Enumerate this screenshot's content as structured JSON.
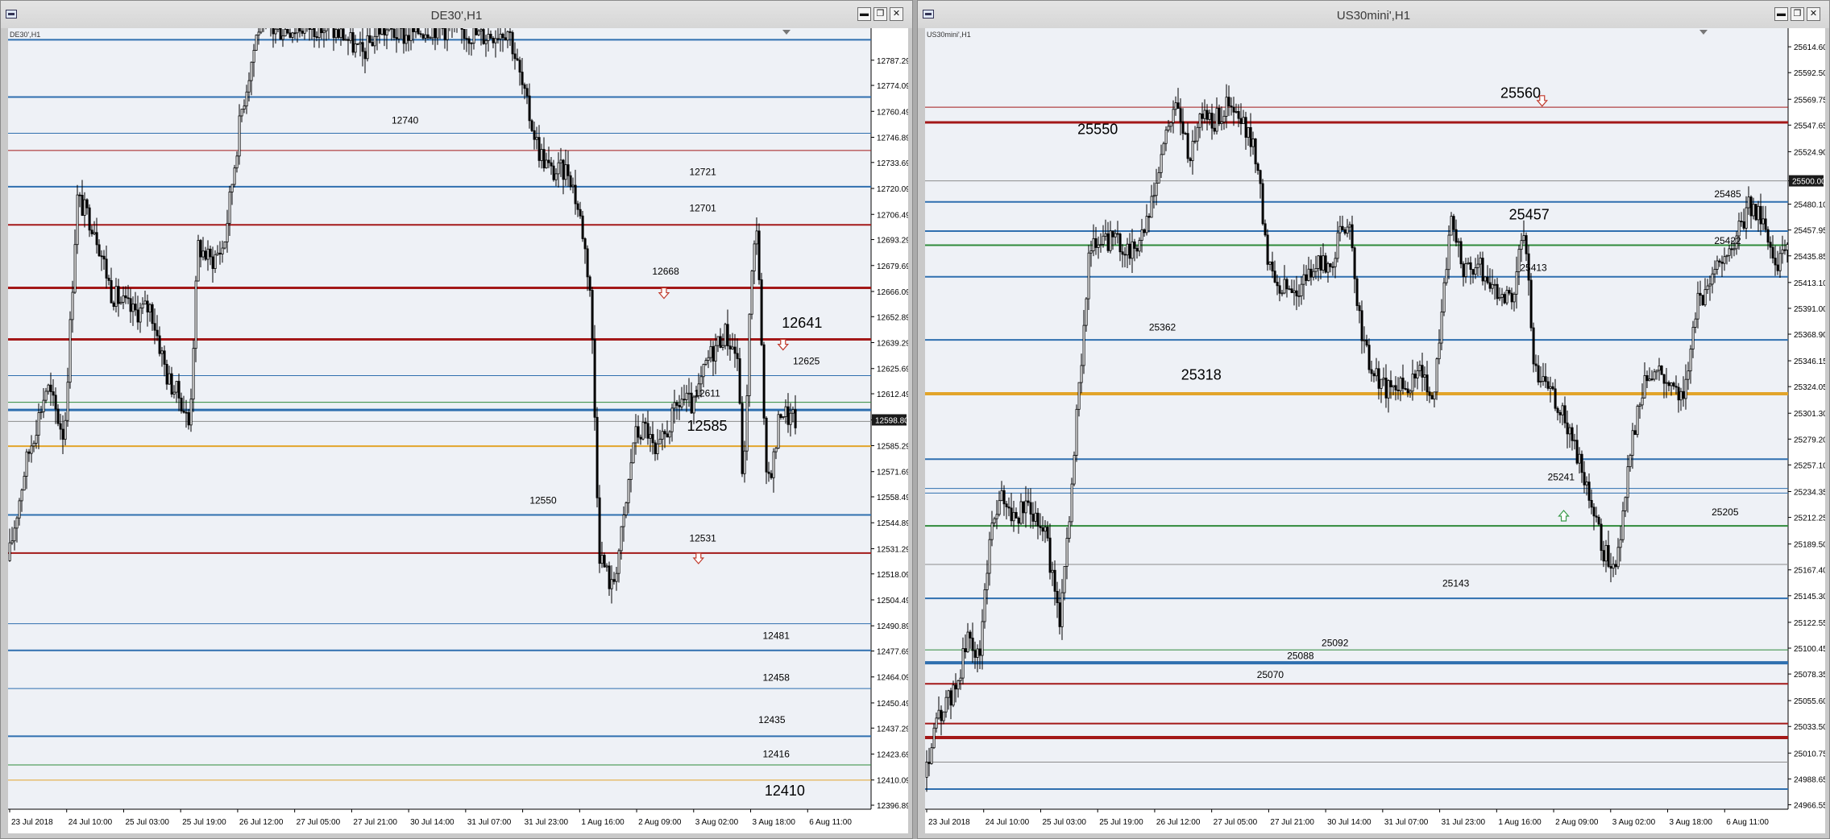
{
  "windows": [
    {
      "title": "DE30',H1",
      "symbol_label": "DE30',H1",
      "buttons": {
        "minimize": "▬",
        "restore": "❐",
        "close": "✕"
      },
      "current_price_tag": "12598.80"
    },
    {
      "title": "US30mini',H1",
      "symbol_label": "US30mini',H1",
      "buttons": {
        "minimize": "▬",
        "restore": "❐",
        "close": "✕"
      },
      "current_price_tag": "25500.00"
    }
  ],
  "colors": {
    "chart_bg": "#eef1f6",
    "blue_line": "#2f6faf",
    "red_line": "#a31818",
    "orange_line": "#e2a42a",
    "green_line": "#2f8a3a",
    "gray_line": "#8c8c8c",
    "arrow_down": "#c0392b",
    "arrow_up": "#3a9a4a",
    "candle": "#000000"
  },
  "chart_data": [
    {
      "type": "line",
      "symbol": "DE30'",
      "timeframe": "H1",
      "ylim": [
        12396.89,
        12800.69
      ],
      "y_ticks": [
        "12787.29",
        "12774.09",
        "12760.49",
        "12746.89",
        "12733.69",
        "12720.09",
        "12706.49",
        "12693.29",
        "12679.69",
        "12666.09",
        "12652.89",
        "12639.29",
        "12625.69",
        "12612.49",
        "12598.80",
        "12585.29",
        "12571.69",
        "12558.49",
        "12544.89",
        "12531.29",
        "12518.09",
        "12504.49",
        "12490.89",
        "12477.69",
        "12464.09",
        "12450.49",
        "12437.29",
        "12423.69",
        "12410.09",
        "12396.89"
      ],
      "x_ticks": [
        "23 Jul 2018",
        "24 Jul 10:00",
        "25 Jul 03:00",
        "25 Jul 19:00",
        "26 Jul 12:00",
        "27 Jul 05:00",
        "27 Jul 21:00",
        "30 Jul 14:00",
        "31 Jul 07:00",
        "31 Jul 23:00",
        "1 Aug 16:00",
        "2 Aug 09:00",
        "3 Aug 02:00",
        "3 Aug 18:00",
        "6 Aug 11:00"
      ],
      "current_price": 12598.8,
      "levels": [
        {
          "value": 12798,
          "color": "blue",
          "width": 2
        },
        {
          "value": 12768,
          "color": "blue",
          "width": 2
        },
        {
          "value": 12749,
          "color": "blue",
          "width": 1
        },
        {
          "value": 12740,
          "color": "red",
          "width": 1
        },
        {
          "value": 12721,
          "color": "blue",
          "width": 2
        },
        {
          "value": 12701,
          "color": "red",
          "width": 2
        },
        {
          "value": 12668,
          "color": "red",
          "width": 3
        },
        {
          "value": 12641,
          "color": "red",
          "width": 3
        },
        {
          "value": 12622,
          "color": "blue",
          "width": 1
        },
        {
          "value": 12608,
          "color": "green",
          "width": 1
        },
        {
          "value": 12604,
          "color": "blue",
          "width": 3
        },
        {
          "value": 12598,
          "color": "gray",
          "width": 1
        },
        {
          "value": 12585,
          "color": "orange",
          "width": 2
        },
        {
          "value": 12549,
          "color": "blue",
          "width": 2
        },
        {
          "value": 12529,
          "color": "red",
          "width": 2
        },
        {
          "value": 12492,
          "color": "blue",
          "width": 1
        },
        {
          "value": 12478,
          "color": "blue",
          "width": 2
        },
        {
          "value": 12458,
          "color": "blue",
          "width": 1
        },
        {
          "value": 12433,
          "color": "blue",
          "width": 2
        },
        {
          "value": 12418,
          "color": "green",
          "width": 1
        },
        {
          "value": 12410,
          "color": "orange",
          "width": 1
        }
      ],
      "labels": [
        {
          "text": "12740",
          "value": 12754,
          "x_frac": 0.46,
          "big": false
        },
        {
          "text": "12721",
          "value": 12727,
          "x_frac": 0.805,
          "big": false
        },
        {
          "text": "12701",
          "value": 12708,
          "x_frac": 0.805,
          "big": false
        },
        {
          "text": "12668",
          "value": 12675,
          "x_frac": 0.762,
          "big": false
        },
        {
          "text": "12641",
          "value": 12647,
          "x_frac": 0.92,
          "big": true
        },
        {
          "text": "12625",
          "value": 12628,
          "x_frac": 0.925,
          "big": false
        },
        {
          "text": "12611",
          "value": 12611,
          "x_frac": 0.81,
          "big": false
        },
        {
          "text": "12585",
          "value": 12593,
          "x_frac": 0.81,
          "big": true
        },
        {
          "text": "12550",
          "value": 12555,
          "x_frac": 0.62,
          "big": false
        },
        {
          "text": "12531",
          "value": 12535,
          "x_frac": 0.805,
          "big": false
        },
        {
          "text": "12481",
          "value": 12484,
          "x_frac": 0.89,
          "big": false
        },
        {
          "text": "12458",
          "value": 12462,
          "x_frac": 0.89,
          "big": false
        },
        {
          "text": "12435",
          "value": 12440,
          "x_frac": 0.885,
          "big": false
        },
        {
          "text": "12416",
          "value": 12422,
          "x_frac": 0.89,
          "big": false
        },
        {
          "text": "12410",
          "value": 12402,
          "x_frac": 0.9,
          "big": true
        }
      ],
      "arrows": [
        {
          "dir": "down",
          "value": 12665,
          "x_frac": 0.76
        },
        {
          "dir": "down",
          "value": 12638,
          "x_frac": 0.898
        },
        {
          "dir": "down",
          "value": 12526,
          "x_frac": 0.8
        }
      ],
      "price_path": [
        [
          0.0,
          12525
        ],
        [
          0.02,
          12575
        ],
        [
          0.045,
          12617
        ],
        [
          0.065,
          12590
        ],
        [
          0.08,
          12715
        ],
        [
          0.1,
          12700
        ],
        [
          0.12,
          12665
        ],
        [
          0.145,
          12655
        ],
        [
          0.165,
          12658
        ],
        [
          0.185,
          12620
        ],
        [
          0.2,
          12610
        ],
        [
          0.21,
          12595
        ],
        [
          0.22,
          12690
        ],
        [
          0.235,
          12682
        ],
        [
          0.25,
          12690
        ],
        [
          0.27,
          12760
        ],
        [
          0.29,
          12805
        ],
        [
          0.31,
          12803
        ],
        [
          0.34,
          12805
        ],
        [
          0.36,
          12805
        ],
        [
          0.39,
          12800
        ],
        [
          0.41,
          12790
        ],
        [
          0.43,
          12804
        ],
        [
          0.46,
          12800
        ],
        [
          0.49,
          12805
        ],
        [
          0.52,
          12803
        ],
        [
          0.55,
          12800
        ],
        [
          0.58,
          12804
        ],
        [
          0.6,
          12765
        ],
        [
          0.615,
          12740
        ],
        [
          0.63,
          12728
        ],
        [
          0.65,
          12730
        ],
        [
          0.665,
          12700
        ],
        [
          0.675,
          12665
        ],
        [
          0.685,
          12530
        ],
        [
          0.7,
          12510
        ],
        [
          0.715,
          12550
        ],
        [
          0.725,
          12590
        ],
        [
          0.74,
          12595
        ],
        [
          0.75,
          12578
        ],
        [
          0.765,
          12595
        ],
        [
          0.78,
          12610
        ],
        [
          0.795,
          12605
        ],
        [
          0.81,
          12630
        ],
        [
          0.83,
          12645
        ],
        [
          0.845,
          12632
        ],
        [
          0.852,
          12560
        ],
        [
          0.86,
          12665
        ],
        [
          0.868,
          12705
        ],
        [
          0.878,
          12565
        ],
        [
          0.888,
          12580
        ],
        [
          0.895,
          12605
        ],
        [
          0.905,
          12600
        ],
        [
          0.915,
          12598
        ]
      ]
    },
    {
      "type": "line",
      "symbol": "US30mini'",
      "timeframe": "H1",
      "ylim": [
        24966.2,
        25625.0
      ],
      "y_ticks": [
        "25614.60",
        "25592.50",
        "25569.75",
        "25547.65",
        "25524.90",
        "25500.00",
        "25480.10",
        "25457.95",
        "25435.85",
        "25413.10",
        "25391.00",
        "25368.90",
        "25346.15",
        "25324.05",
        "25301.30",
        "25279.20",
        "25257.10",
        "25234.35",
        "25212.25",
        "25189.50",
        "25167.40",
        "25145.30",
        "25122.55",
        "25100.45",
        "25078.35",
        "25055.60",
        "25033.50",
        "25010.75",
        "24988.65",
        "24966.55"
      ],
      "x_ticks": [
        "23 Jul 2018",
        "24 Jul 10:00",
        "25 Jul 03:00",
        "25 Jul 19:00",
        "26 Jul 12:00",
        "27 Jul 05:00",
        "27 Jul 21:00",
        "30 Jul 14:00",
        "31 Jul 07:00",
        "31 Jul 23:00",
        "1 Aug 16:00",
        "2 Aug 09:00",
        "3 Aug 02:00",
        "3 Aug 18:00",
        "6 Aug 11:00"
      ],
      "current_price": 25500.0,
      "levels": [
        {
          "value": 25563,
          "color": "red",
          "width": 1
        },
        {
          "value": 25550,
          "color": "red",
          "width": 3
        },
        {
          "value": 25500,
          "color": "gray",
          "width": 1
        },
        {
          "value": 25482,
          "color": "blue",
          "width": 2
        },
        {
          "value": 25457,
          "color": "blue",
          "width": 2
        },
        {
          "value": 25445,
          "color": "green",
          "width": 2
        },
        {
          "value": 25418,
          "color": "blue",
          "width": 2
        },
        {
          "value": 25364,
          "color": "blue",
          "width": 2
        },
        {
          "value": 25318,
          "color": "orange",
          "width": 4
        },
        {
          "value": 25262,
          "color": "blue",
          "width": 2
        },
        {
          "value": 25237,
          "color": "blue",
          "width": 1
        },
        {
          "value": 25233,
          "color": "blue",
          "width": 1
        },
        {
          "value": 25205,
          "color": "green",
          "width": 2
        },
        {
          "value": 25172,
          "color": "gray",
          "width": 1
        },
        {
          "value": 25143,
          "color": "blue",
          "width": 2
        },
        {
          "value": 25099,
          "color": "green",
          "width": 1
        },
        {
          "value": 25088,
          "color": "blue",
          "width": 4
        },
        {
          "value": 25070,
          "color": "red",
          "width": 2
        },
        {
          "value": 25036,
          "color": "red",
          "width": 2
        },
        {
          "value": 25024,
          "color": "red",
          "width": 4
        },
        {
          "value": 25003,
          "color": "gray",
          "width": 1
        },
        {
          "value": 24980,
          "color": "blue",
          "width": 2
        }
      ],
      "labels": [
        {
          "text": "25560",
          "value": 25571,
          "x_frac": 0.69,
          "big": true
        },
        {
          "text": "25550",
          "value": 25540,
          "x_frac": 0.2,
          "big": true
        },
        {
          "text": "25485",
          "value": 25486,
          "x_frac": 0.93,
          "big": false
        },
        {
          "text": "25457",
          "value": 25467,
          "x_frac": 0.7,
          "big": true
        },
        {
          "text": "25422",
          "value": 25446,
          "x_frac": 0.93,
          "big": false
        },
        {
          "text": "25413",
          "value": 25423,
          "x_frac": 0.705,
          "big": false
        },
        {
          "text": "25362",
          "value": 25372,
          "x_frac": 0.275,
          "big": false
        },
        {
          "text": "25318",
          "value": 25330,
          "x_frac": 0.32,
          "big": true
        },
        {
          "text": "25241",
          "value": 25244,
          "x_frac": 0.737,
          "big": false
        },
        {
          "text": "25205",
          "value": 25214,
          "x_frac": 0.927,
          "big": false
        },
        {
          "text": "25143",
          "value": 25153,
          "x_frac": 0.615,
          "big": false
        },
        {
          "text": "25092",
          "value": 25102,
          "x_frac": 0.475,
          "big": false
        },
        {
          "text": "25088",
          "value": 25091,
          "x_frac": 0.435,
          "big": false
        },
        {
          "text": "25070",
          "value": 25075,
          "x_frac": 0.4,
          "big": false
        }
      ],
      "arrows": [
        {
          "dir": "down",
          "value": 25568,
          "x_frac": 0.715
        },
        {
          "dir": "up",
          "value": 25214,
          "x_frac": 0.74
        }
      ],
      "price_path": [
        [
          0.0,
          24990
        ],
        [
          0.015,
          25040
        ],
        [
          0.035,
          25065
        ],
        [
          0.05,
          25110
        ],
        [
          0.063,
          25090
        ],
        [
          0.075,
          25200
        ],
        [
          0.09,
          25230
        ],
        [
          0.105,
          25210
        ],
        [
          0.12,
          25225
        ],
        [
          0.14,
          25200
        ],
        [
          0.155,
          25120
        ],
        [
          0.17,
          25240
        ],
        [
          0.19,
          25440
        ],
        [
          0.215,
          25450
        ],
        [
          0.24,
          25440
        ],
        [
          0.26,
          25468
        ],
        [
          0.275,
          25525
        ],
        [
          0.29,
          25570
        ],
        [
          0.305,
          25520
        ],
        [
          0.32,
          25560
        ],
        [
          0.335,
          25550
        ],
        [
          0.35,
          25565
        ],
        [
          0.37,
          25545
        ],
        [
          0.385,
          25520
        ],
        [
          0.395,
          25440
        ],
        [
          0.41,
          25410
        ],
        [
          0.43,
          25405
        ],
        [
          0.45,
          25425
        ],
        [
          0.47,
          25430
        ],
        [
          0.49,
          25470
        ],
        [
          0.5,
          25395
        ],
        [
          0.515,
          25340
        ],
        [
          0.535,
          25320
        ],
        [
          0.555,
          25325
        ],
        [
          0.575,
          25335
        ],
        [
          0.59,
          25320
        ],
        [
          0.6,
          25405
        ],
        [
          0.61,
          25465
        ],
        [
          0.625,
          25420
        ],
        [
          0.64,
          25430
        ],
        [
          0.66,
          25405
        ],
        [
          0.68,
          25400
        ],
        [
          0.695,
          25460
        ],
        [
          0.705,
          25340
        ],
        [
          0.72,
          25330
        ],
        [
          0.74,
          25300
        ],
        [
          0.755,
          25265
        ],
        [
          0.77,
          25225
        ],
        [
          0.785,
          25185
        ],
        [
          0.8,
          25170
        ],
        [
          0.81,
          25225
        ],
        [
          0.82,
          25280
        ],
        [
          0.835,
          25335
        ],
        [
          0.85,
          25340
        ],
        [
          0.865,
          25325
        ],
        [
          0.88,
          25320
        ],
        [
          0.895,
          25395
        ],
        [
          0.91,
          25415
        ],
        [
          0.925,
          25440
        ],
        [
          0.94,
          25450
        ],
        [
          0.955,
          25480
        ],
        [
          0.97,
          25470
        ],
        [
          0.985,
          25430
        ],
        [
          1.0,
          25440
        ],
        [
          1.015,
          25495
        ],
        [
          1.03,
          25470
        ],
        [
          1.045,
          25410
        ],
        [
          1.06,
          25480
        ],
        [
          1.075,
          25520
        ],
        [
          1.09,
          25500
        ]
      ]
    }
  ]
}
